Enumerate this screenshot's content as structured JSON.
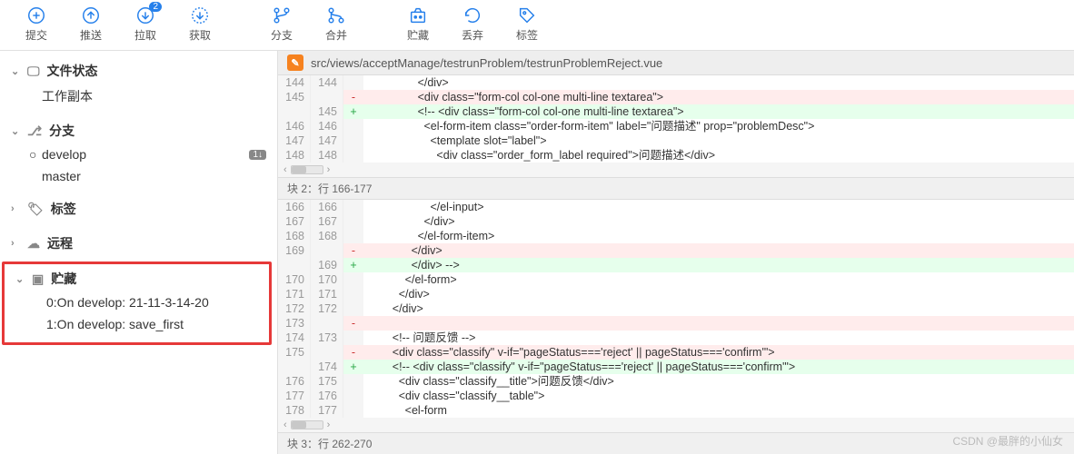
{
  "toolbar": {
    "commit": "提交",
    "push": "推送",
    "pull": "拉取",
    "fetch": "获取",
    "branch": "分支",
    "merge": "合并",
    "stash": "贮藏",
    "discard": "丢弃",
    "tag": "标签",
    "pull_badge": "2"
  },
  "sidebar": {
    "file_status": "文件状态",
    "working_copy": "工作副本",
    "branches": "分支",
    "branch_list": [
      {
        "name": "develop",
        "current": true,
        "count": "1↓"
      },
      {
        "name": "master",
        "current": false
      }
    ],
    "tags": "标签",
    "remotes": "远程",
    "stashes": "贮藏",
    "stash_list": [
      "0:On develop: 21-11-3-14-20",
      "1:On develop: save_first"
    ]
  },
  "file": {
    "path": "src/views/acceptManage/testrunProblem/testrunProblemReject.vue"
  },
  "hunks": [
    {
      "rows": [
        {
          "a": "144",
          "b": "144",
          "t": " ",
          "c": "                </div>"
        },
        {
          "a": "145",
          "b": "",
          "t": "-",
          "c": "                <div class=\"form-col col-one multi-line textarea\">"
        },
        {
          "a": "",
          "b": "145",
          "t": "+",
          "c": "                <!-- <div class=\"form-col col-one multi-line textarea\">"
        },
        {
          "a": "146",
          "b": "146",
          "t": " ",
          "c": "                  <el-form-item class=\"order-form-item\" label=\"问题描述\" prop=\"problemDesc\">"
        },
        {
          "a": "147",
          "b": "147",
          "t": " ",
          "c": "                    <template slot=\"label\">"
        },
        {
          "a": "148",
          "b": "148",
          "t": " ",
          "c": "                      <div class=\"order_form_label required\">问题描述</div>"
        }
      ],
      "footer": "块 2：行 166-177"
    },
    {
      "rows": [
        {
          "a": "166",
          "b": "166",
          "t": " ",
          "c": "                    </el-input>"
        },
        {
          "a": "167",
          "b": "167",
          "t": " ",
          "c": "                  </div>"
        },
        {
          "a": "168",
          "b": "168",
          "t": " ",
          "c": "                </el-form-item>"
        },
        {
          "a": "169",
          "b": "",
          "t": "-",
          "c": "              </div>"
        },
        {
          "a": "",
          "b": "169",
          "t": "+",
          "c": "              </div> -->"
        },
        {
          "a": "170",
          "b": "170",
          "t": " ",
          "c": "            </el-form>"
        },
        {
          "a": "171",
          "b": "171",
          "t": " ",
          "c": "          </div>"
        },
        {
          "a": "172",
          "b": "172",
          "t": " ",
          "c": "        </div>"
        },
        {
          "a": "173",
          "b": "",
          "t": "-",
          "c": ""
        },
        {
          "a": "174",
          "b": "173",
          "t": " ",
          "c": "        <!-- 问题反馈 -->"
        },
        {
          "a": "175",
          "b": "",
          "t": "-",
          "c": "        <div class=\"classify\" v-if=\"pageStatus==='reject' || pageStatus==='confirm'\">"
        },
        {
          "a": "",
          "b": "174",
          "t": "+",
          "c": "        <!-- <div class=\"classify\" v-if=\"pageStatus==='reject' || pageStatus==='confirm'\">"
        },
        {
          "a": "176",
          "b": "175",
          "t": " ",
          "c": "          <div class=\"classify__title\">问题反馈</div>"
        },
        {
          "a": "177",
          "b": "176",
          "t": " ",
          "c": "          <div class=\"classify__table\">"
        },
        {
          "a": "178",
          "b": "177",
          "t": " ",
          "c": "            <el-form"
        }
      ],
      "footer": "块 3：行 262-270"
    }
  ],
  "watermark": "CSDN @最胖的小仙女"
}
